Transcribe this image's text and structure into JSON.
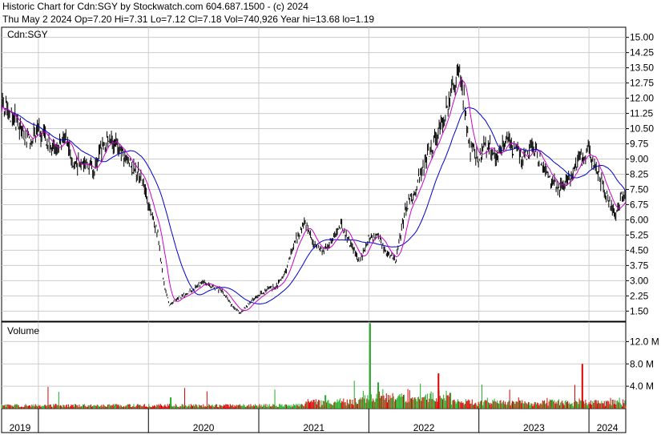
{
  "header": {
    "line1": "Historic Chart for Cdn:SGY by Stockwatch.com 604.687.1500 - (c) 2024",
    "line2": "Thu May  2 2024  Op=7.20  Hi=7.31  Lo=7.12  Cl=7.18  Vol=740,926  Year hi=13.68  lo=1.19"
  },
  "price_panel": {
    "label": "Cdn:SGY"
  },
  "volume_panel": {
    "label": "Volume"
  },
  "colors": {
    "price_bar": "#000000",
    "ma_short": "#cc00cc",
    "ma_long": "#0000cc",
    "vol_up": "#22aa22",
    "vol_down": "#dd0000",
    "grid": "#cccccc",
    "frame": "#000000"
  },
  "chart_data": {
    "type": "line",
    "title": "Historic Chart for Cdn:SGY by Stockwatch.com 604.687.1500 - (c) 2024",
    "ylim": [
      1.0,
      15.5
    ],
    "price_ticks": [
      "15.00",
      "14.25",
      "13.50",
      "12.75",
      "12.00",
      "11.25",
      "10.50",
      "9.75",
      "9.00",
      "8.25",
      "7.50",
      "6.75",
      "6.00",
      "5.25",
      "4.50",
      "3.75",
      "3.00",
      "2.25",
      "1.50"
    ],
    "volume_ticks": [
      "12.0 M",
      "8.0 M",
      "4.0 M"
    ],
    "volume_ylim": [
      0,
      15.5
    ],
    "xlim": [
      "2018-09-01",
      "2024-05-02"
    ],
    "x_ticks": [
      {
        "label": "2019",
        "date": "2019-01-01"
      },
      {
        "label": "2020",
        "date": "2020-01-01"
      },
      {
        "label": "2021",
        "date": "2021-01-01"
      },
      {
        "label": "2022",
        "date": "2022-01-01"
      },
      {
        "label": "2023",
        "date": "2023-01-01"
      },
      {
        "label": "2024",
        "date": "2024-01-01"
      }
    ],
    "series": [
      {
        "kind": "price",
        "points": [
          [
            "2018-09-01",
            11.7
          ],
          [
            "2018-10-01",
            11.2
          ],
          [
            "2018-11-01",
            10.6
          ],
          [
            "2018-12-01",
            9.9
          ],
          [
            "2019-01-01",
            10.4
          ],
          [
            "2019-02-01",
            10.0
          ],
          [
            "2019-03-01",
            9.3
          ],
          [
            "2019-04-01",
            10.0
          ],
          [
            "2019-05-01",
            8.6
          ],
          [
            "2019-06-01",
            8.9
          ],
          [
            "2019-07-01",
            8.4
          ],
          [
            "2019-08-01",
            9.6
          ],
          [
            "2019-09-01",
            9.9
          ],
          [
            "2019-10-01",
            9.3
          ],
          [
            "2019-11-01",
            8.8
          ],
          [
            "2019-12-01",
            8.3
          ],
          [
            "2020-01-01",
            6.8
          ],
          [
            "2020-02-01",
            5.3
          ],
          [
            "2020-02-20",
            3.0
          ],
          [
            "2020-03-10",
            1.8
          ],
          [
            "2020-04-01",
            2.1
          ],
          [
            "2020-05-01",
            2.3
          ],
          [
            "2020-06-01",
            2.6
          ],
          [
            "2020-07-01",
            2.9
          ],
          [
            "2020-08-01",
            2.7
          ],
          [
            "2020-09-01",
            2.5
          ],
          [
            "2020-10-01",
            1.8
          ],
          [
            "2020-11-01",
            1.4
          ],
          [
            "2020-12-01",
            1.9
          ],
          [
            "2021-01-01",
            2.3
          ],
          [
            "2021-02-01",
            2.6
          ],
          [
            "2021-03-01",
            2.7
          ],
          [
            "2021-04-01",
            3.5
          ],
          [
            "2021-05-01",
            5.0
          ],
          [
            "2021-06-01",
            5.8
          ],
          [
            "2021-07-01",
            4.9
          ],
          [
            "2021-08-01",
            4.5
          ],
          [
            "2021-09-01",
            5.1
          ],
          [
            "2021-10-01",
            5.8
          ],
          [
            "2021-11-01",
            4.8
          ],
          [
            "2021-12-01",
            3.9
          ],
          [
            "2022-01-01",
            5.1
          ],
          [
            "2022-02-01",
            5.2
          ],
          [
            "2022-03-01",
            4.3
          ],
          [
            "2022-04-01",
            4.0
          ],
          [
            "2022-05-01",
            6.4
          ],
          [
            "2022-06-01",
            7.4
          ],
          [
            "2022-07-01",
            8.6
          ],
          [
            "2022-08-01",
            9.7
          ],
          [
            "2022-09-01",
            10.6
          ],
          [
            "2022-10-01",
            12.4
          ],
          [
            "2022-11-01",
            13.3
          ],
          [
            "2022-12-01",
            9.6
          ],
          [
            "2023-01-01",
            9.0
          ],
          [
            "2023-02-01",
            9.8
          ],
          [
            "2023-03-01",
            9.0
          ],
          [
            "2023-04-01",
            10.0
          ],
          [
            "2023-05-01",
            9.4
          ],
          [
            "2023-06-01",
            9.0
          ],
          [
            "2023-07-01",
            9.6
          ],
          [
            "2023-08-01",
            8.7
          ],
          [
            "2023-09-01",
            7.8
          ],
          [
            "2023-10-01",
            7.6
          ],
          [
            "2023-11-01",
            8.1
          ],
          [
            "2023-12-01",
            9.0
          ],
          [
            "2024-01-01",
            9.3
          ],
          [
            "2024-02-01",
            8.3
          ],
          [
            "2024-03-01",
            7.1
          ],
          [
            "2024-03-20",
            6.6
          ],
          [
            "2024-04-01",
            6.2
          ],
          [
            "2024-04-15",
            7.2
          ],
          [
            "2024-05-02",
            7.18
          ]
        ]
      }
    ]
  }
}
